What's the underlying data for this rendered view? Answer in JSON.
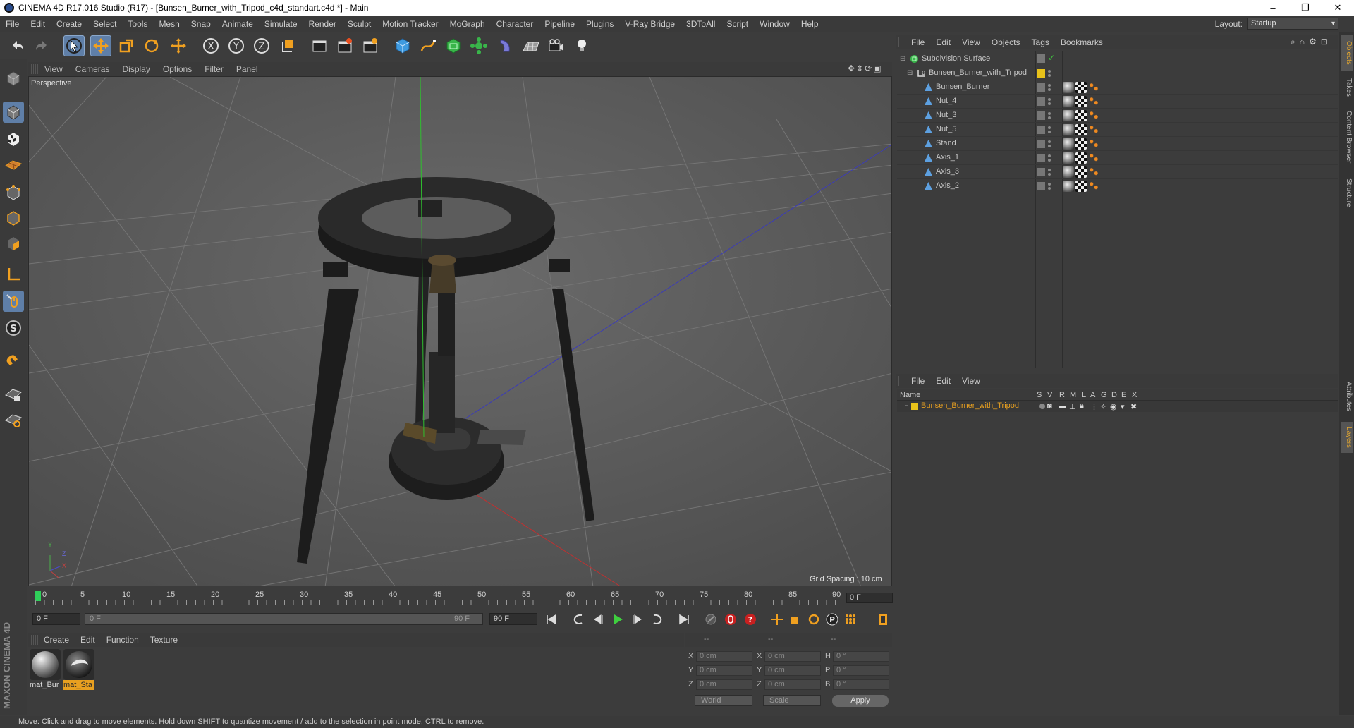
{
  "window": {
    "title": "CINEMA 4D R17.016 Studio (R17) - [Bunsen_Burner_with_Tripod_c4d_standart.c4d *] - Main",
    "controls": [
      "–",
      "❐",
      "✕"
    ]
  },
  "menu": [
    "File",
    "Edit",
    "Create",
    "Select",
    "Tools",
    "Mesh",
    "Snap",
    "Animate",
    "Simulate",
    "Render",
    "Sculpt",
    "Motion Tracker",
    "MoGraph",
    "Character",
    "Pipeline",
    "Plugins",
    "V-Ray Bridge",
    "3DToAll",
    "Script",
    "Window",
    "Help"
  ],
  "layout": {
    "label": "Layout:",
    "value": "Startup"
  },
  "toolbar_icons": [
    "undo-icon",
    "redo-icon",
    "live-selection-icon",
    "move-icon",
    "scale-icon",
    "rotate-icon",
    "recent-tool-icon",
    "x-axis-icon",
    "y-axis-icon",
    "z-axis-icon",
    "coordinate-system-icon",
    "render-view-icon",
    "render-picture-viewer-icon",
    "edit-render-settings-icon",
    "cube-icon",
    "spline-pen-icon",
    "subdivision-icon",
    "array-icon",
    "deformer-icon",
    "floor-icon",
    "camera-icon",
    "light-icon"
  ],
  "viewport": {
    "menu": [
      "View",
      "Cameras",
      "Display",
      "Options",
      "Filter",
      "Panel"
    ],
    "label": "Perspective",
    "grid_spacing": "Grid Spacing : 10 cm",
    "axis_labels": {
      "y": "Y",
      "z": "Z",
      "x": "X"
    }
  },
  "timeline": {
    "ticks": [
      "0",
      "5",
      "10",
      "15",
      "20",
      "25",
      "30",
      "35",
      "40",
      "45",
      "50",
      "55",
      "60",
      "65",
      "70",
      "75",
      "80",
      "85",
      "90"
    ],
    "current_frame": "0 F",
    "start_field": "0 F",
    "range_start": "0 F",
    "range_end": "90 F",
    "end_field": "90 F"
  },
  "materials": {
    "menu": [
      "Create",
      "Edit",
      "Function",
      "Texture"
    ],
    "items": [
      {
        "label": "mat_Bur",
        "selected": false
      },
      {
        "label": "mat_Sta",
        "selected": true
      }
    ]
  },
  "coordinates": {
    "header": [
      "--",
      "--",
      "--"
    ],
    "rows": [
      {
        "a": "X",
        "av": "0 cm",
        "b": "X",
        "bv": "0 cm",
        "c": "H",
        "cv": "0 °"
      },
      {
        "a": "Y",
        "av": "0 cm",
        "b": "Y",
        "bv": "0 cm",
        "c": "P",
        "cv": "0 °"
      },
      {
        "a": "Z",
        "av": "0 cm",
        "b": "Z",
        "bv": "0 cm",
        "c": "B",
        "cv": "0 °"
      }
    ],
    "mode": "World",
    "scale": "Scale",
    "apply": "Apply"
  },
  "status": "Move: Click and drag to move elements. Hold down SHIFT to quantize movement / add to the selection in point mode, CTRL to remove.",
  "objects": {
    "menu": [
      "File",
      "Edit",
      "View",
      "Objects",
      "Tags",
      "Bookmarks"
    ],
    "items": [
      {
        "name": "Subdivision Surface",
        "indent": 0,
        "kind": "subdivision"
      },
      {
        "name": "Bunsen_Burner_with_Tripod",
        "indent": 1,
        "kind": "null"
      },
      {
        "name": "Bunsen_Burner",
        "indent": 2,
        "kind": "polygon"
      },
      {
        "name": "Nut_4",
        "indent": 2,
        "kind": "polygon"
      },
      {
        "name": "Nut_3",
        "indent": 2,
        "kind": "polygon"
      },
      {
        "name": "Nut_5",
        "indent": 2,
        "kind": "polygon"
      },
      {
        "name": "Stand",
        "indent": 2,
        "kind": "polygon"
      },
      {
        "name": "Axis_1",
        "indent": 2,
        "kind": "polygon"
      },
      {
        "name": "Axis_3",
        "indent": 2,
        "kind": "polygon"
      },
      {
        "name": "Axis_2",
        "indent": 2,
        "kind": "polygon"
      }
    ]
  },
  "layers": {
    "menu": [
      "File",
      "Edit",
      "View"
    ],
    "header": {
      "name": "Name",
      "cols": [
        "S",
        "V",
        "R",
        "M",
        "L",
        "A",
        "G",
        "D",
        "E",
        "X"
      ]
    },
    "items": [
      {
        "name": "Bunsen_Burner_with_Tripod",
        "color": "#e8c21a"
      }
    ]
  },
  "side_tabs": [
    "Objects",
    "Takes",
    "Content Browser",
    "Structure",
    "Attributes",
    "Layers"
  ],
  "colors": {
    "accent": "#e8a020",
    "selection": "#5f7fa8",
    "layer_yellow": "#e8c21a"
  },
  "brand": "MAXON CINEMA 4D"
}
